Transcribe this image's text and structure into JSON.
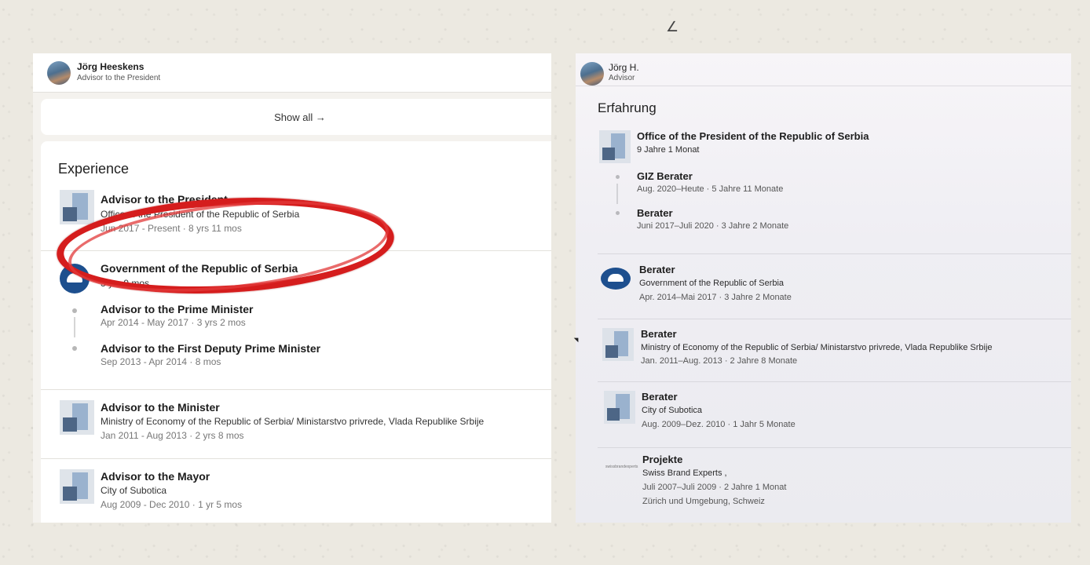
{
  "left": {
    "header": {
      "name": "Jörg Heeskens",
      "role": "Advisor to the President"
    },
    "show_all": "Show all →",
    "section_title": "Experience",
    "entries": [
      {
        "title": "Advisor to the President",
        "org": "Office of the President of the Republic of Serbia",
        "dates": "Jun 2017 - Present · 8 yrs 11 mos"
      },
      {
        "title": "Government of the Republic of Serbia",
        "org": "3 yrs 9 mos",
        "roles": [
          {
            "title": "Advisor to the Prime Minister",
            "dates": "Apr 2014 - May 2017 · 3 yrs 2 mos"
          },
          {
            "title": "Advisor to the First Deputy Prime Minister",
            "dates": "Sep 2013 - Apr 2014 · 8 mos"
          }
        ]
      },
      {
        "title": "Advisor to the Minister",
        "org": "Ministry of Economy of the Republic of Serbia/ Ministarstvo privrede, Vlada Republike Srbije",
        "dates": "Jan 2011 - Aug 2013 · 2 yrs 8 mos"
      },
      {
        "title": "Advisor to the Mayor",
        "org": "City of Subotica",
        "dates": "Aug 2009 - Dec 2010 · 1 yr 5 mos"
      }
    ]
  },
  "right": {
    "header": {
      "name": "Jörg H.",
      "role": "Advisor"
    },
    "section_title": "Erfahrung",
    "entries": [
      {
        "title": "Office of the President of the Republic of Serbia",
        "duration": "9 Jahre 1 Monat",
        "roles": [
          {
            "title": "GIZ Berater",
            "dates": "Aug. 2020–Heute · 5 Jahre 11 Monate"
          },
          {
            "title": "Berater",
            "dates": "Juni 2017–Juli 2020 · 3 Jahre 2 Monate"
          }
        ]
      },
      {
        "title": "Berater",
        "org": "Government of the Republic of Serbia",
        "dates": "Apr. 2014–Mai 2017 · 3 Jahre 2 Monate"
      },
      {
        "title": "Berater",
        "org": "Ministry of Economy of the Republic of Serbia/ Ministarstvo privrede, Vlada Republike Srbije",
        "dates": "Jan. 2011–Aug. 2013 · 2 Jahre 8 Monate"
      },
      {
        "title": "Berater",
        "org": "City of Subotica",
        "dates": "Aug. 2009–Dez. 2010 · 1 Jahr 5 Monate"
      },
      {
        "title": "Projekte",
        "org": "Swiss Brand Experts ,",
        "dates": "Juli 2007–Juli 2009 · 2 Jahre 1 Monat",
        "location": "Zürich und Umgebung, Schweiz",
        "logo_text": "swissbrandexperts"
      }
    ]
  },
  "colors": {
    "annotation_red": "#d51d1d",
    "gov_blue": "#1d4f8e",
    "logo_light": "#9ab2ce",
    "logo_dark": "#4d6686"
  }
}
